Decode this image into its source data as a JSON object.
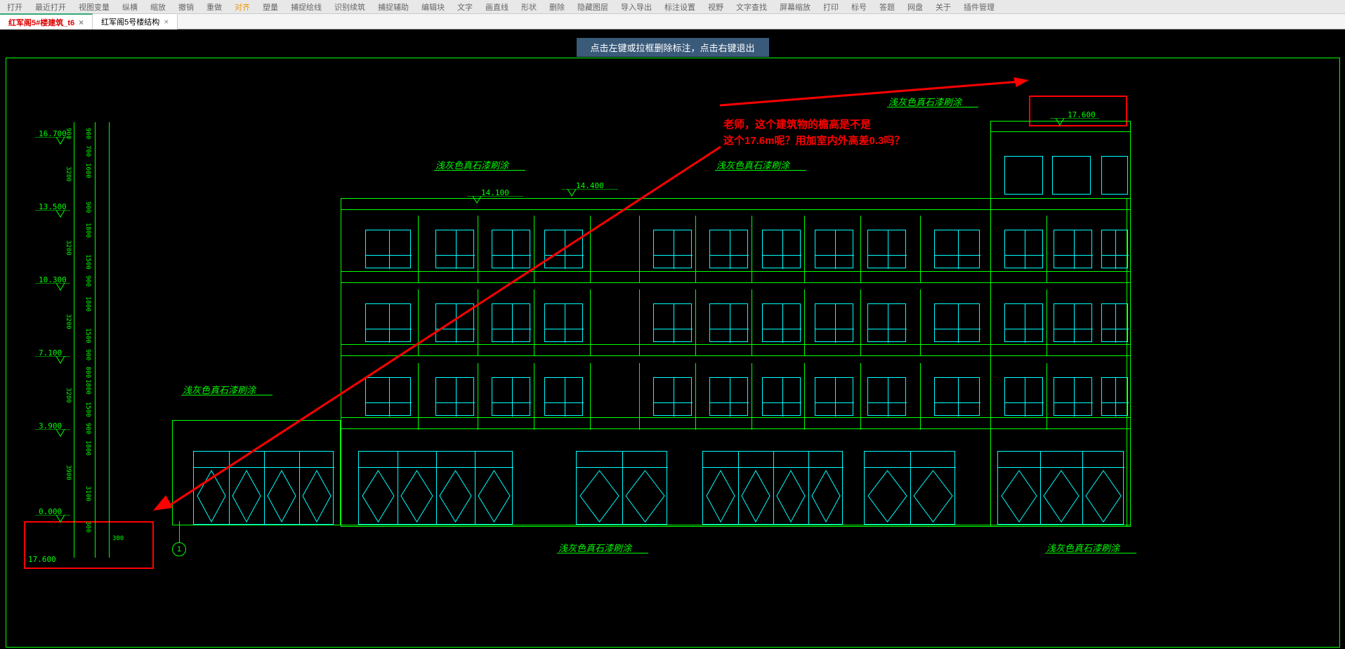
{
  "menubar": {
    "items": [
      "打开",
      "最近打开",
      "视图变量",
      "纵横",
      "缩放",
      "撤销",
      "重做",
      "对齐",
      "塑量",
      "捕捉绘线",
      "识别续筑",
      "捕捉辅助",
      "编辑块",
      "文字",
      "画直线",
      "形状",
      "删除",
      "隐藏图层",
      "导入导出",
      "标注设置",
      "视野",
      "文字查找",
      "屏幕缩放",
      "打印",
      "标号",
      "答题",
      "网盘",
      "关于",
      "插件管理"
    ]
  },
  "tabs": [
    {
      "label": "红军阁5#楼建筑_t6",
      "active": true
    },
    {
      "label": "红军阁5号楼结构",
      "active": false
    }
  ],
  "hint": "点击左键或拉框删除标注，点击右键退出",
  "annotation": {
    "line1": "老师，这个建筑物的檐高是不是",
    "line2": "这个17.6m呢？用加室内外高差0.3吗？"
  },
  "elevations": {
    "top": "17.600",
    "e1": "16.700",
    "e2": "13.500",
    "e3": "10.300",
    "e4": "7.100",
    "e5": "3.900",
    "e6": "0.000",
    "e7": "17.600",
    "mid1": "14.100",
    "mid2": "14.400"
  },
  "dims": {
    "d900": "900",
    "d700": "700",
    "d3200": "3200",
    "d1600": "1600",
    "d1800": "1800",
    "d1500": "1500",
    "d800": "800",
    "d3900": "3900",
    "d3100": "3100",
    "d300": "300"
  },
  "paint_label": "浅灰色真石漆刷涂",
  "grid": {
    "num1": "1"
  }
}
